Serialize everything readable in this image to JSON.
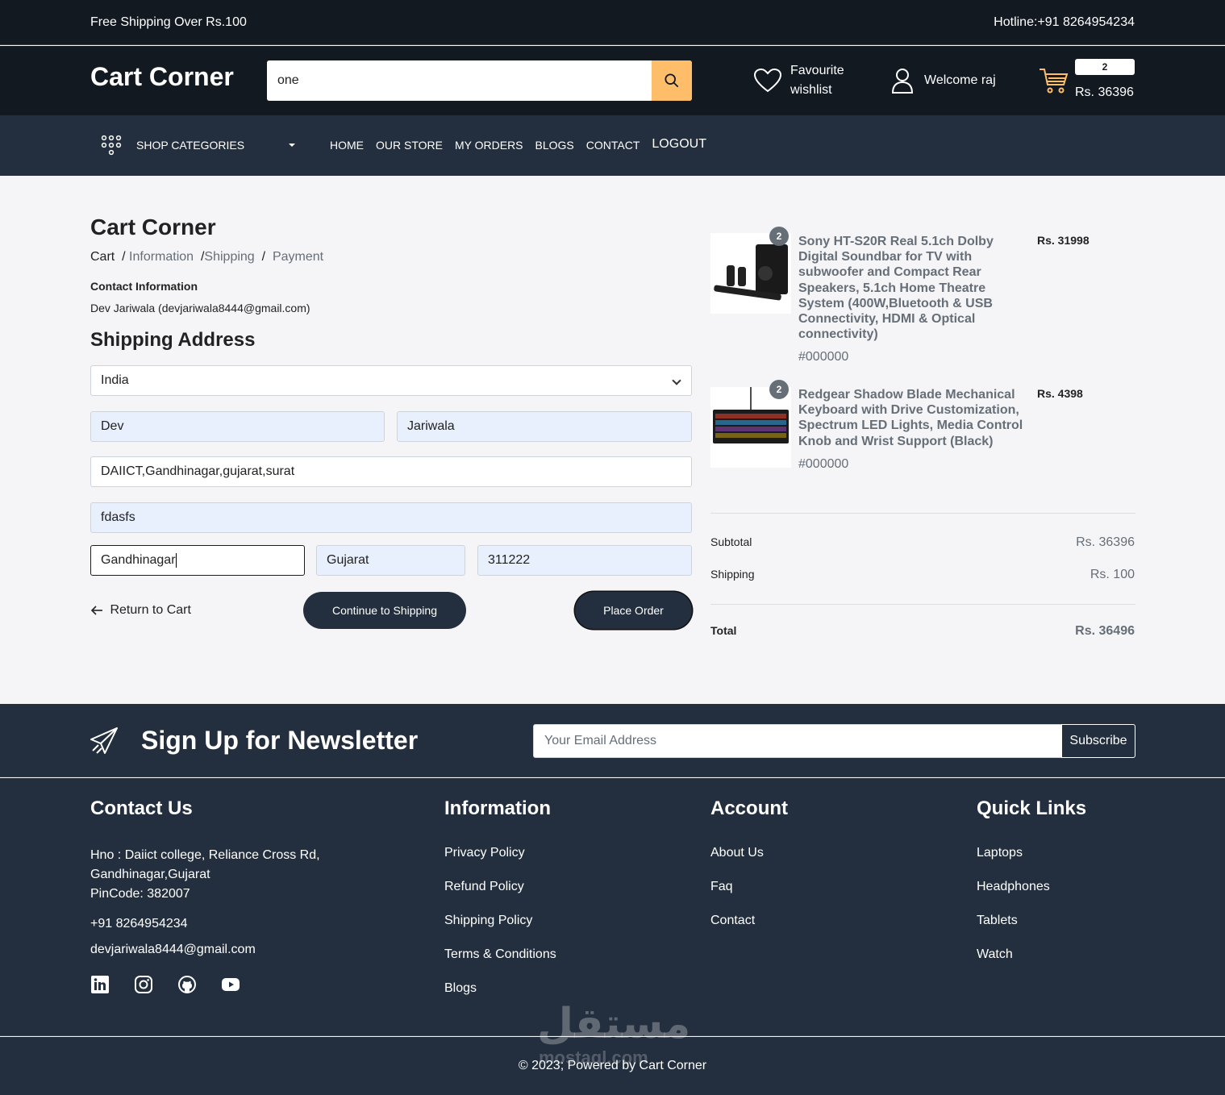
{
  "topbar": {
    "shipping_note": "Free Shipping Over Rs.100",
    "hotline": "Hotline:+91 8264954234"
  },
  "header": {
    "logo": "Cart Corner",
    "search_value": "one",
    "favourite_line1": "Favourite",
    "favourite_line2": "wishlist",
    "welcome": "Welcome raj",
    "cart_count": "2",
    "cart_total": "Rs. 36396"
  },
  "nav": {
    "categories_label": "SHOP CATEGORIES",
    "links": [
      "HOME",
      "OUR STORE",
      "MY ORDERS",
      "BLOGS",
      "CONTACT",
      "LOGOUT"
    ]
  },
  "checkout": {
    "title": "Cart Corner",
    "breadcrumb": [
      "Cart",
      "Information",
      "Shipping",
      "Payment"
    ],
    "contact_label": "Contact Information",
    "contact_value": "Dev Jariwala (devjariwala8444@gmail.com)",
    "shipping_title": "Shipping Address",
    "country": "India",
    "first_name": "Dev",
    "last_name": "Jariwala",
    "address": "DAIICT,Gandhinagar,gujarat,surat",
    "apartment": "fdasfs",
    "city": "Gandhinagar",
    "state": "Gujarat",
    "pincode": "311222",
    "return_label": "Return to Cart",
    "continue_label": "Continue to Shipping",
    "place_order_label": "Place Order"
  },
  "summary": {
    "items": [
      {
        "qty": "2",
        "name": "Sony HT-S20R Real 5.1ch Dolby Digital Soundbar for TV with subwoofer and Compact Rear Speakers, 5.1ch Home Theatre System (400W,Bluetooth & USB Connectivity, HDMI & Optical connectivity)",
        "color": "#000000",
        "price": "Rs. 31998"
      },
      {
        "qty": "2",
        "name": "Redgear Shadow Blade Mechanical Keyboard with Drive Customization, Spectrum LED Lights, Media Control Knob and Wrist Support (Black)",
        "color": "#000000",
        "price": "Rs. 4398"
      }
    ],
    "subtotal_label": "Subtotal",
    "subtotal_value": "Rs. 36396",
    "shipping_label": "Shipping",
    "shipping_value": "Rs. 100",
    "total_label": "Total",
    "total_value": "Rs. 36496"
  },
  "newsletter": {
    "title": "Sign Up for Newsletter",
    "email_placeholder": "Your Email Address",
    "subscribe_label": "Subscribe"
  },
  "footer": {
    "contact_title": "Contact Us",
    "address_line1": "Hno : Daiict college, Reliance Cross Rd,",
    "address_line2": "Gandhinagar,Gujarat",
    "address_line3": "PinCode: 382007",
    "phone": "+91 8264954234",
    "email": "devjariwala8444@gmail.com",
    "information_title": "Information",
    "information_links": [
      "Privacy Policy",
      "Refund Policy",
      "Shipping Policy",
      "Terms & Conditions",
      "Blogs"
    ],
    "account_title": "Account",
    "account_links": [
      "About Us",
      "Faq",
      "Contact"
    ],
    "quick_title": "Quick Links",
    "quick_links": [
      "Laptops",
      "Headphones",
      "Tablets",
      "Watch"
    ],
    "copyright": "© 2023; Powered by Cart Corner",
    "watermark": "مستقل",
    "watermark_sub": "mostaql.com"
  },
  "colors": {
    "dark": "#131921",
    "navy": "#232f3e",
    "accent": "#febd69",
    "muted": "#666e78"
  }
}
